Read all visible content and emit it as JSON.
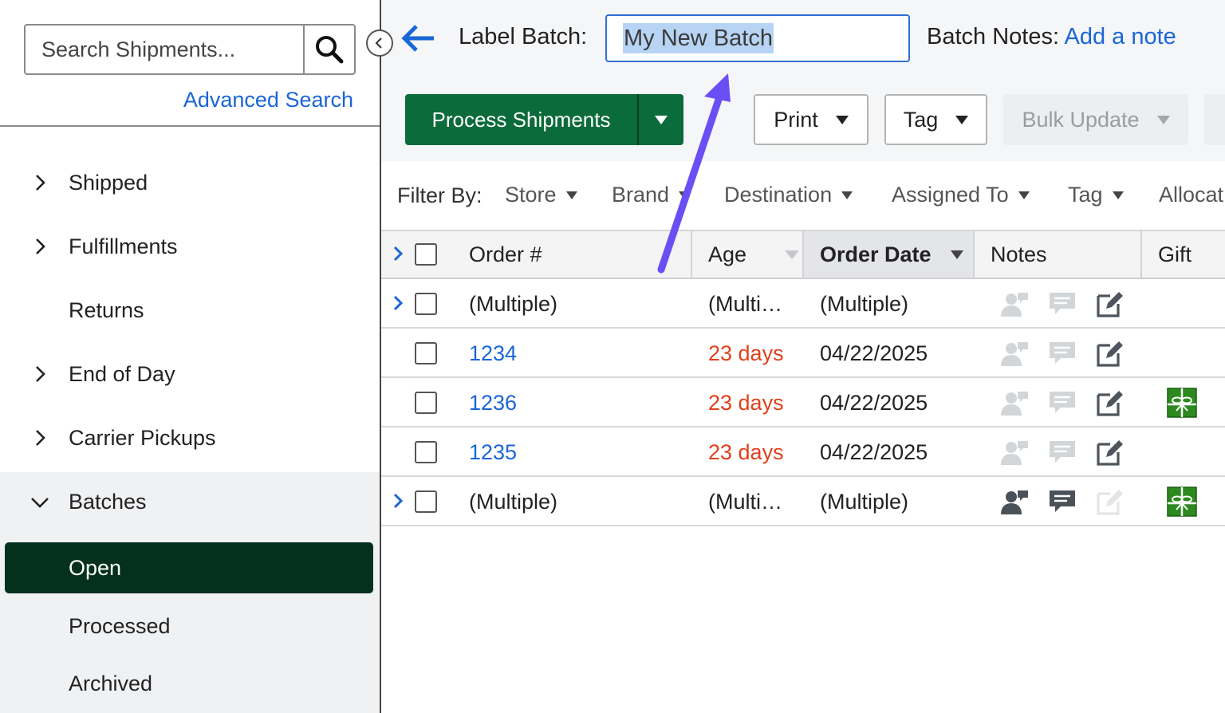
{
  "sidebar": {
    "search_placeholder": "Search Shipments...",
    "advanced_search": "Advanced Search",
    "items": [
      {
        "label": "Shipped"
      },
      {
        "label": "Fulfillments"
      },
      {
        "label": "Returns"
      },
      {
        "label": "End of Day"
      },
      {
        "label": "Carrier Pickups"
      },
      {
        "label": "Batches"
      }
    ],
    "batch_items": [
      {
        "label": "Open",
        "active": true
      },
      {
        "label": "Processed"
      },
      {
        "label": "Archived"
      }
    ]
  },
  "header": {
    "label_batch": "Label Batch:",
    "batch_name": "My New Batch",
    "batch_notes_label": "Batch Notes:",
    "batch_notes_link": "Add a note"
  },
  "toolbar": {
    "process": "Process Shipments",
    "print": "Print",
    "tag": "Tag",
    "bulk_update": "Bulk Update"
  },
  "filters": {
    "label": "Filter By:",
    "items": [
      "Store",
      "Brand",
      "Destination",
      "Assigned To",
      "Tag",
      "Allocat"
    ]
  },
  "table": {
    "columns": [
      "Order #",
      "Age",
      "Order Date",
      "Notes",
      "Gift"
    ],
    "rows": [
      {
        "order": "(Multiple)",
        "age": "(Multi…",
        "date": "(Multiple)",
        "link": false,
        "expandable": true
      },
      {
        "order": "1234",
        "age": "23 days",
        "date": "04/22/2025",
        "link": true,
        "expandable": false
      },
      {
        "order": "1236",
        "age": "23 days",
        "date": "04/22/2025",
        "link": true,
        "expandable": false
      },
      {
        "order": "1235",
        "age": "23 days",
        "date": "04/22/2025",
        "link": true,
        "expandable": false
      },
      {
        "order": "(Multiple)",
        "age": "(Multi…",
        "date": "(Multiple)",
        "link": false,
        "expandable": true
      }
    ]
  },
  "colors": {
    "accent_green": "#0c6b3a",
    "active_nav": "#03311e",
    "link_blue": "#1a66d6",
    "age_red": "#e0401b",
    "annotation_arrow": "#6a4ff5"
  }
}
